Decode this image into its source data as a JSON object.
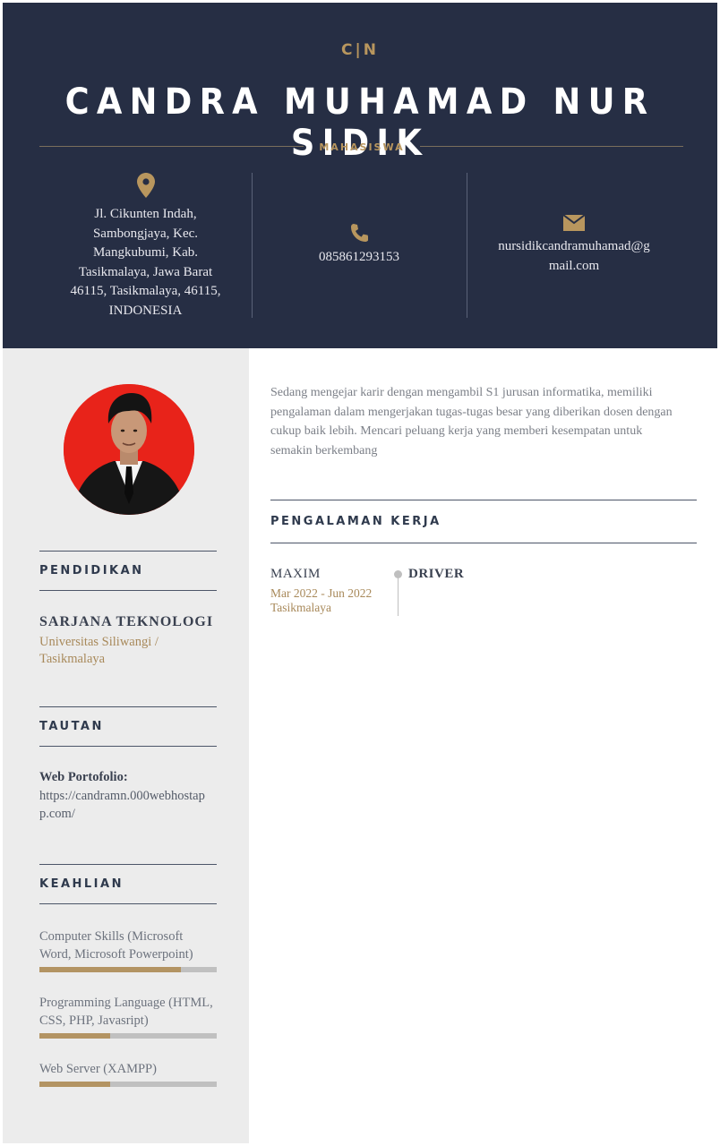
{
  "header": {
    "monogram": "C|N",
    "name": "CANDRA MUHAMAD NUR SIDIK",
    "role": "MAHASISWA",
    "address_lines": [
      "Jl. Cikunten Indah,",
      "Sambongjaya, Kec.",
      "Mangkubumi, Kab.",
      "Tasikmalaya, Jawa Barat",
      "46115, Tasikmalaya, 46115,",
      "INDONESIA"
    ],
    "phone": "085861293153",
    "email_lines": [
      "nursidikcandramuhamad@g",
      "mail.com"
    ],
    "icons": [
      "map-pin-icon",
      "phone-icon",
      "envelope-icon"
    ],
    "accent_color": "#b8965e",
    "background_color": "#262e44"
  },
  "sidebar": {
    "education": {
      "title": "PENDIDIKAN",
      "degree": "SARJANA TEKNOLOGI",
      "school_lines": [
        "Universitas Siliwangi /",
        "Tasikmalaya"
      ]
    },
    "links": {
      "title": "TAUTAN",
      "label": "Web Portofolio:",
      "url_lines": [
        "https://candramn.000webhostap",
        "p.com/"
      ]
    },
    "skills": {
      "title": "KEAHLIAN",
      "items": [
        {
          "name_lines": [
            "Computer Skills (Microsoft",
            "Word, Microsoft Powerpoint)"
          ],
          "level": 0.8
        },
        {
          "name_lines": [
            "Programming Language (HTML,",
            "CSS, PHP, Javasript)"
          ],
          "level": 0.4
        },
        {
          "name_lines": [
            "Web Server (XAMPP)"
          ],
          "level": 0.4
        }
      ]
    }
  },
  "main": {
    "summary_lines": [
      "Sedang mengejar karir dengan mengambil S1 jurusan informatika, memiliki",
      "pengalaman dalam mengerjakan tugas-tugas besar yang diberikan dosen dengan",
      "cukup baik lebih. Mencari peluang kerja yang memberi kesempatan untuk",
      "semakin berkembang"
    ],
    "experience": {
      "title": "PENGALAMAN KERJA",
      "items": [
        {
          "company": "MAXIM",
          "dates": "Mar 2022 - Jun 2022",
          "location": "Tasikmalaya",
          "role": "DRIVER"
        }
      ]
    }
  }
}
